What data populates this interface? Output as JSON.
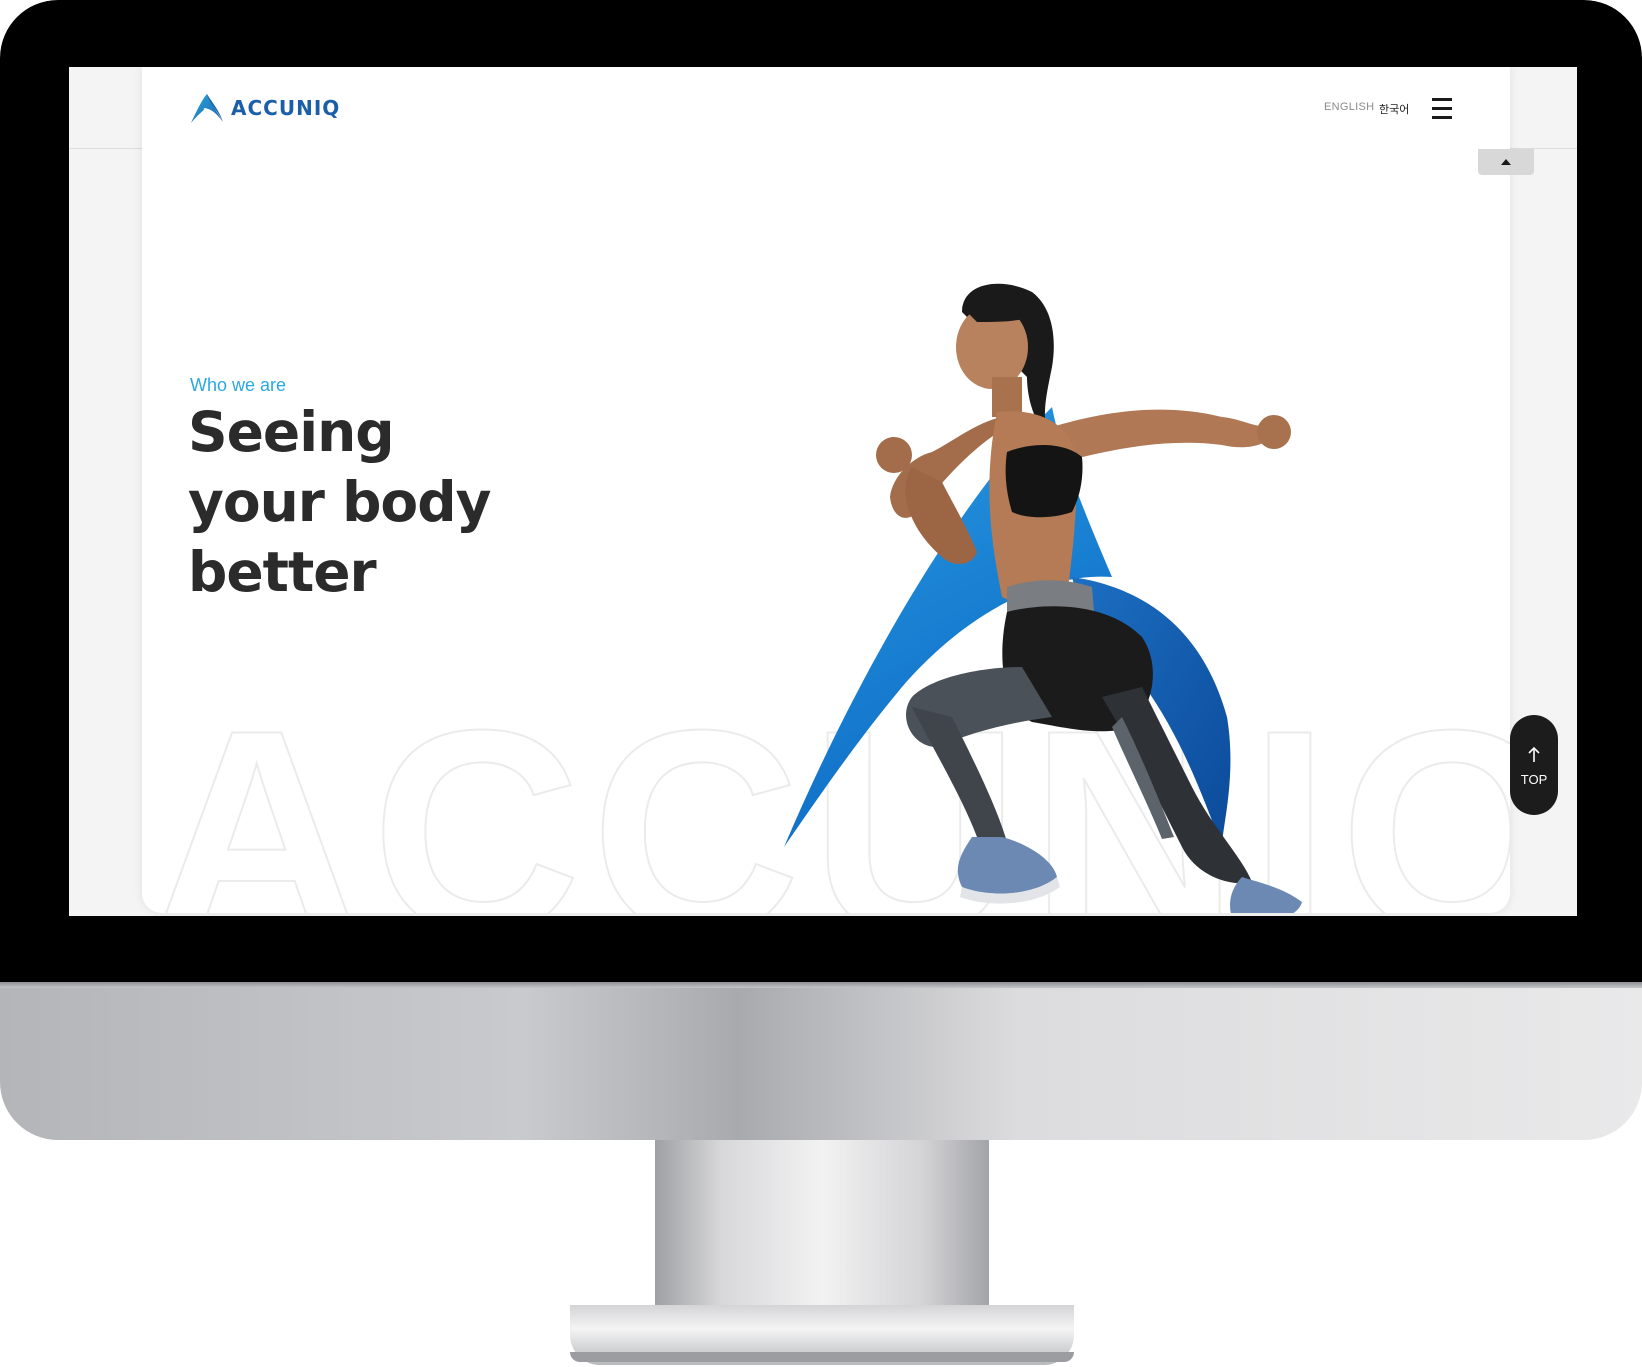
{
  "header": {
    "logo_text": "ACCUNIQ",
    "lang_english": "ENGLISH",
    "lang_korean": "한국어"
  },
  "hero": {
    "tagline": "Who we are",
    "headline": "Seeing\nyour body\nbetter",
    "watermark_text": "ACCUNIQ"
  },
  "top_button": {
    "label": "TOP"
  },
  "icons": {
    "menu": "hamburger-menu-icon",
    "scroll_up": "caret-up-icon",
    "top_arrow": "arrow-up-icon",
    "logo": "accuniq-a-logo-icon"
  },
  "colors": {
    "brand_blue": "#1b5fa8",
    "accent_blue": "#2aa8e2",
    "headline": "#2b2b2b",
    "top_button_bg": "#1c1c1c"
  }
}
